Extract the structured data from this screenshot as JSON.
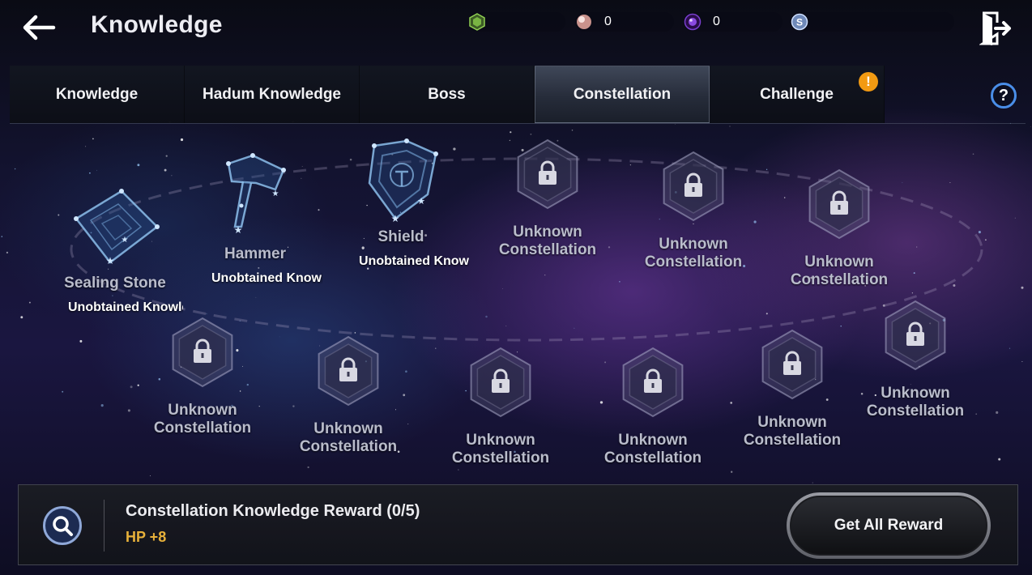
{
  "header": {
    "title": "Knowledge",
    "back_icon": "arrow-left-icon",
    "exit_icon": "exit-door-icon",
    "currencies": [
      {
        "id": "green-gem",
        "icon": "green-crystal-icon",
        "value": "",
        "color": "#6fa83a"
      },
      {
        "id": "pearl",
        "icon": "pearl-icon",
        "value": "0",
        "color": "#e4b7b0"
      },
      {
        "id": "purple-orb",
        "icon": "purple-orb-icon",
        "value": "0",
        "color": "#6b2fb8"
      },
      {
        "id": "silver-coin",
        "icon": "silver-coin-icon",
        "value": "",
        "color": "#a9c4ee"
      }
    ]
  },
  "tabs": [
    {
      "label": "Knowledge",
      "active": false
    },
    {
      "label": "Hadum Knowledge",
      "active": false
    },
    {
      "label": "Boss",
      "active": false
    },
    {
      "label": "Constellation",
      "active": true
    },
    {
      "label": "Challenge",
      "active": false,
      "alert": "!"
    }
  ],
  "help_label": "?",
  "alert_color": "#f29a12",
  "constellations": [
    {
      "id": "sealing-stone",
      "name": "Sealing Stone",
      "status": "Unobtained Knowledge",
      "unlocked": true,
      "icon": "sealing-stone-constellation-icon"
    },
    {
      "id": "hammer",
      "name": "Hammer",
      "status": "Unobtained Knowledge",
      "unlocked": true,
      "icon": "hammer-constellation-icon"
    },
    {
      "id": "shield",
      "name": "Shield",
      "status": "Unobtained Knowledge",
      "unlocked": true,
      "icon": "shield-constellation-icon"
    },
    {
      "id": "u1",
      "name": "Unknown\nConstellation",
      "unlocked": false,
      "icon": "lock-icon"
    },
    {
      "id": "u2",
      "name": "Unknown\nConstellation",
      "unlocked": false,
      "icon": "lock-icon"
    },
    {
      "id": "u3",
      "name": "Unknown\nConstellation",
      "unlocked": false,
      "icon": "lock-icon"
    },
    {
      "id": "u4",
      "name": "Unknown\nConstellation",
      "unlocked": false,
      "icon": "lock-icon"
    },
    {
      "id": "u5",
      "name": "Unknown\nConstellation",
      "unlocked": false,
      "icon": "lock-icon"
    },
    {
      "id": "u6",
      "name": "Unknown\nConstellation",
      "unlocked": false,
      "icon": "lock-icon"
    },
    {
      "id": "u7",
      "name": "Unknown\nConstellation",
      "unlocked": false,
      "icon": "lock-icon"
    },
    {
      "id": "u8",
      "name": "Unknown\nConstellation",
      "unlocked": false,
      "icon": "lock-icon"
    },
    {
      "id": "u9",
      "name": "Unknown\nConstellation",
      "unlocked": false,
      "icon": "lock-icon"
    }
  ],
  "reward": {
    "title": "Constellation Knowledge Reward (0/5)",
    "value": "HP +8",
    "value_color": "#e8b13a",
    "button_label": "Get All Reward",
    "search_icon": "magnifier-icon"
  }
}
